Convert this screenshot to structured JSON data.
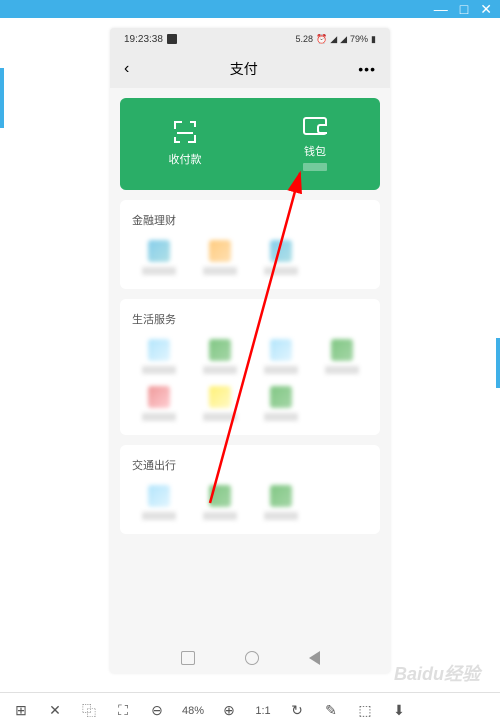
{
  "titlebar": {
    "min": "—",
    "max": "□",
    "close": "✕"
  },
  "statusbar": {
    "time": "19:23:38",
    "small": "5.28",
    "battery": "79%"
  },
  "navbar": {
    "title": "支付"
  },
  "green": {
    "scan_label": "收付款",
    "wallet_label": "钱包"
  },
  "sections": {
    "finance": "金融理财",
    "life": "生活服务",
    "transport": "交通出行"
  },
  "toolbar": {
    "zoom": "48%",
    "ratio": "1:1"
  },
  "watermark": "Baidu经验"
}
